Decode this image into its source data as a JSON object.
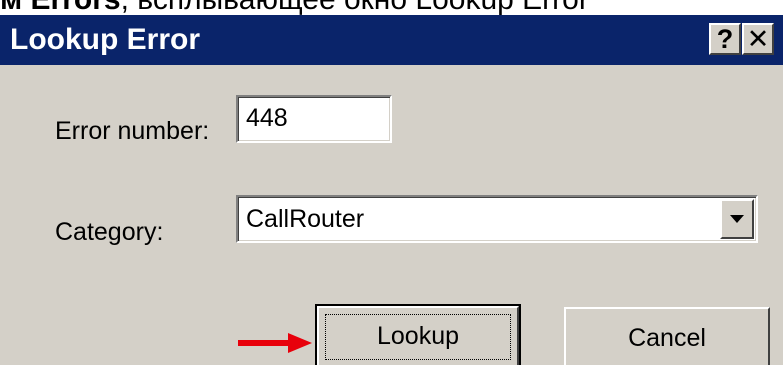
{
  "doc_text": {
    "bold_part": "м Errors",
    "rest": ", всплывающее окно Lookup Error"
  },
  "dialog": {
    "title": "Lookup Error",
    "help_glyph": "?",
    "close_glyph": "✕"
  },
  "form": {
    "error_number_label": "Error number:",
    "error_number_value": "448",
    "category_label": "Category:",
    "category_value": "CallRouter"
  },
  "buttons": {
    "lookup": "Lookup",
    "cancel": "Cancel"
  },
  "colors": {
    "titlebar": "#0a246a",
    "dialog_face": "#d4d0c8",
    "arrow": "#e8000b"
  },
  "icons": {
    "help": "help-icon",
    "close": "close-icon",
    "dropdown": "chevron-down-icon",
    "pointer": "red-arrow-icon"
  }
}
